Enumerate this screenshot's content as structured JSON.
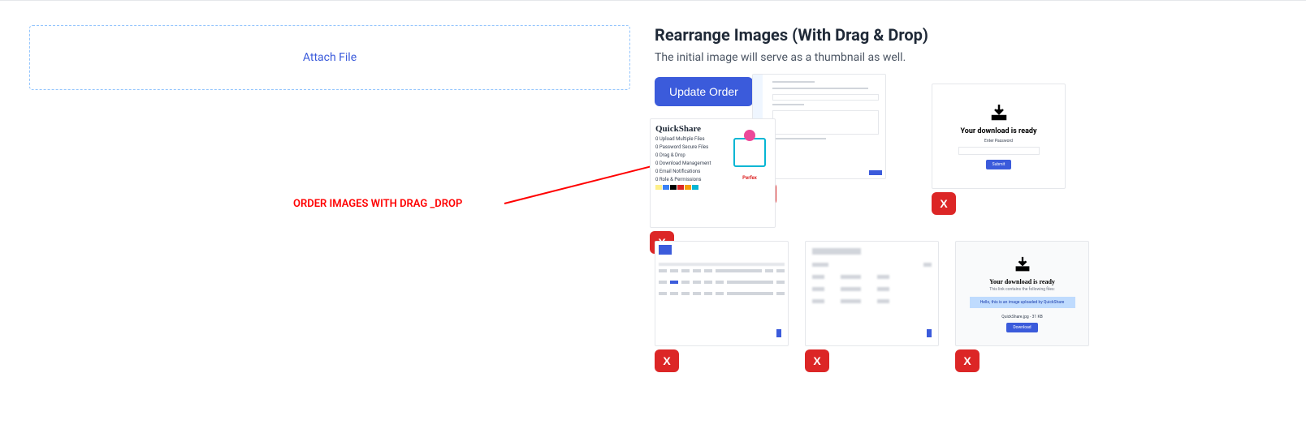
{
  "attach": {
    "label": "Attach File"
  },
  "callout": {
    "text": "ORDER IMAGES WITH DRAG _DROP"
  },
  "rearrange": {
    "title": "Rearrange Images (With Drag & Drop)",
    "subtitle": "The initial image will serve as a thumbnail as well.",
    "update_button": "Update Order"
  },
  "thumbnails": {
    "quickshare": {
      "logo": "QuickShare",
      "items": [
        "0 Upload Multiple Files",
        "0 Password Secure Files",
        "0 Drag & Drop",
        "0 Download Management",
        "0 Email Notifications",
        "0 Role & Permissions"
      ],
      "brand": "Perfex"
    },
    "download_ready": {
      "title": "Your download is ready",
      "enter_password": "Enter Password",
      "submit": "Submit"
    },
    "download_ready2": {
      "title": "Your download is ready",
      "subtitle": "This link contains the following files:",
      "banner": "Hello, this is an image uploaded by QuickShare",
      "file": "QuickShare.jpg - 31 KB",
      "download_btn": "Download"
    }
  },
  "delete_label": "X"
}
